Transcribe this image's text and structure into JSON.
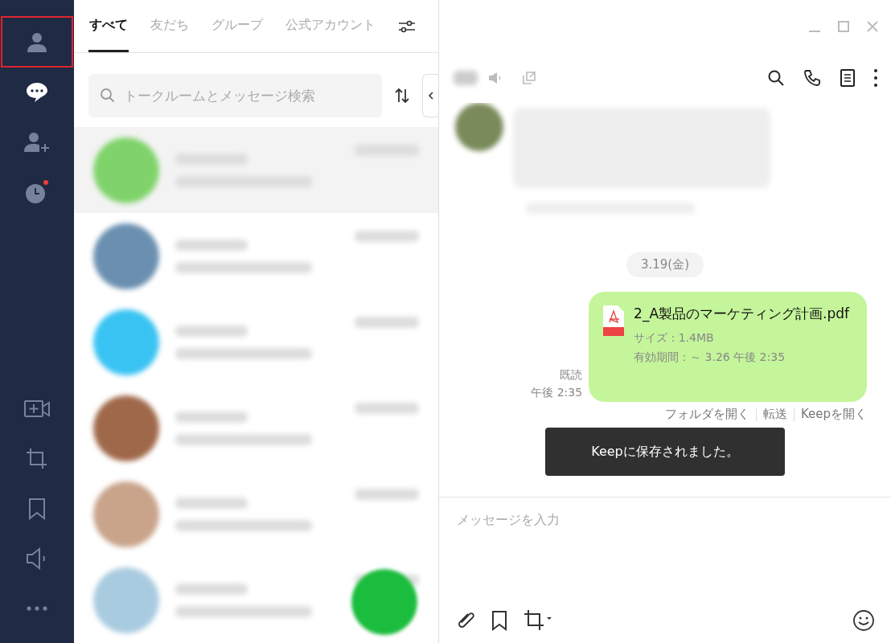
{
  "nav": {
    "top": [
      {
        "kind": "friends",
        "selected": false,
        "highlighted": true
      },
      {
        "kind": "chats",
        "selected": true,
        "highlighted": false
      },
      {
        "kind": "add-friend",
        "selected": false,
        "highlighted": false
      },
      {
        "kind": "timeline",
        "selected": false,
        "highlighted": false,
        "badge": true
      }
    ],
    "bottom": [
      {
        "kind": "video"
      },
      {
        "kind": "crop"
      },
      {
        "kind": "keep"
      },
      {
        "kind": "announce"
      },
      {
        "kind": "more"
      }
    ]
  },
  "tabs": [
    {
      "label": "すべて",
      "selected": true
    },
    {
      "label": "友だち",
      "selected": false
    },
    {
      "label": "グループ",
      "selected": false
    },
    {
      "label": "公式アカウント",
      "selected": false
    }
  ],
  "search": {
    "placeholder": "トークルームとメッセージ検索"
  },
  "chats": [
    {
      "selected": true,
      "color": "#7fd36a"
    },
    {
      "selected": false,
      "color": "#6a8fb0"
    },
    {
      "selected": false,
      "color": "#39c3f2"
    },
    {
      "selected": false,
      "color": "#a0684a"
    },
    {
      "selected": false,
      "color": "#c9a38a"
    },
    {
      "selected": false,
      "color": "#a9cbe0"
    }
  ],
  "chat": {
    "date": "3.19(金)",
    "message": {
      "file_name": "2_A製品のマーケティング計画.pdf",
      "size": "サイズ : 1.4MB",
      "expiry": "有効期間：～ 3.26 午後 2:35",
      "read": "既読",
      "time": "午後 2:35",
      "actions": [
        "フォルダを開く",
        "転送",
        "Keepを開く"
      ]
    },
    "toast": "Keepに保存されました。",
    "input": {
      "placeholder": "メッセージを入力"
    }
  }
}
